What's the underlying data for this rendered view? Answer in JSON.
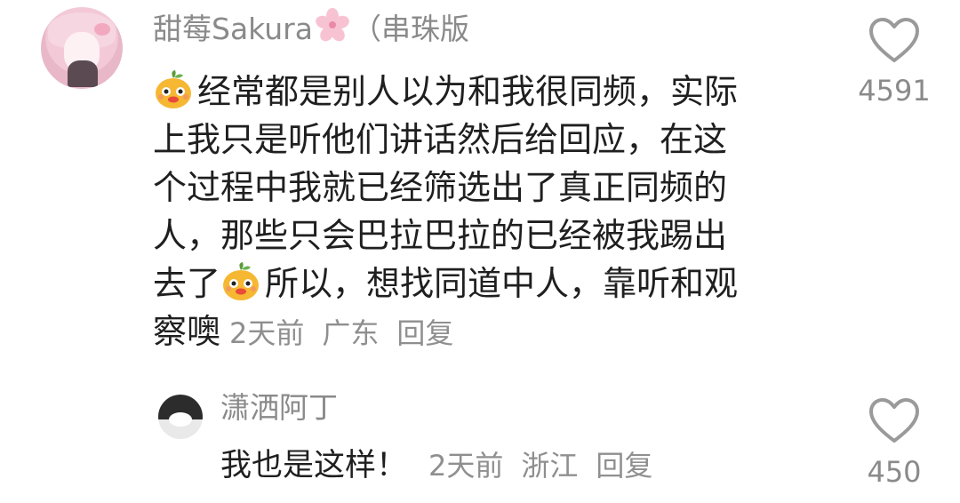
{
  "comment": {
    "username": "甜莓Sakura",
    "username_suffix": "（串珠版",
    "lines": [
      "经常都是别人以为和我很同频，实际",
      "上我只是听他们讲话然后给回应，在这",
      "个过程中我就已经筛选出了真正同频的",
      "人，那些只会巴拉巴拉的已经被我踢出",
      "去了",
      "所以，想找同道中人，靠听和观",
      "察噢"
    ],
    "time": "2天前",
    "location": "广东",
    "reply_label": "回复",
    "like_count": "4591",
    "emoji_icon": "orange-face-emoji",
    "like_icon": "heart-outline-icon"
  },
  "reply": {
    "username": "潇洒阿丁",
    "text": "我也是这样！",
    "time": "2天前",
    "location": "浙江",
    "reply_label": "回复",
    "like_count": "450",
    "like_icon": "heart-outline-icon"
  },
  "colors": {
    "username": "#8a8a8a",
    "text": "#1f1f1f",
    "meta": "#8f8f8f",
    "heart": "#9a9a9a"
  }
}
